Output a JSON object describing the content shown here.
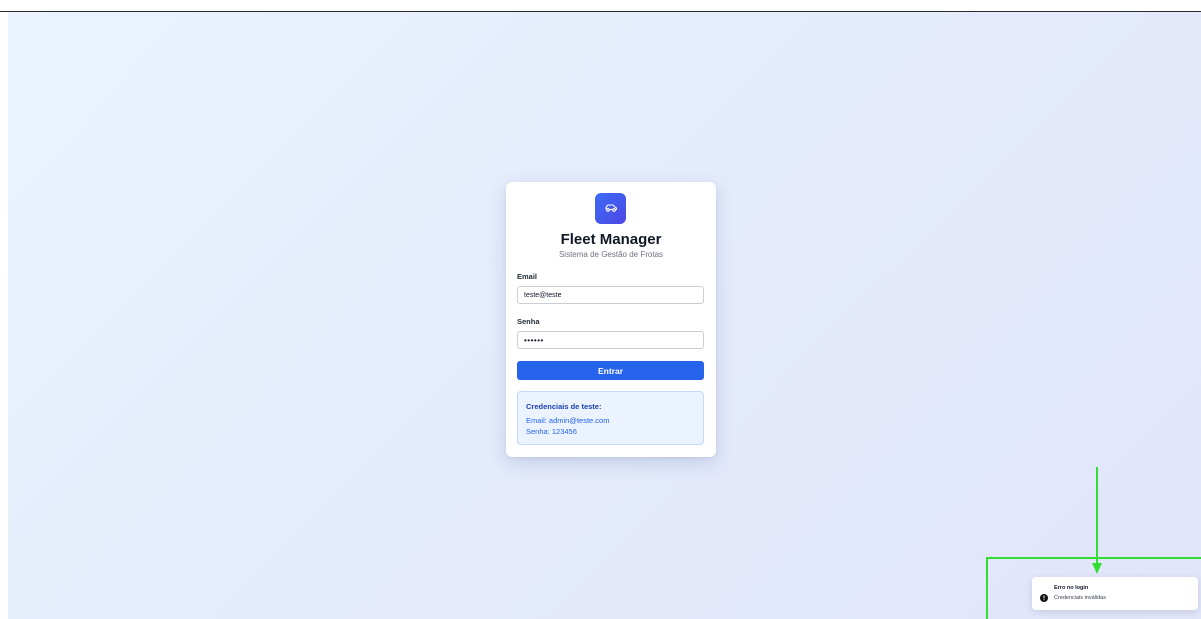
{
  "login": {
    "app_title": "Fleet Manager",
    "subtitle": "Sistema de Gestão de Frotas",
    "email_label": "Email",
    "email_value": "teste@teste",
    "password_label": "Senha",
    "password_value": "••••••",
    "submit_label": "Entrar",
    "credentials": {
      "title": "Credenciais de teste:",
      "email_line": "Email: admin@teste.com",
      "password_line": "Senha: 123456"
    }
  },
  "toast": {
    "title": "Erro no login",
    "message": "Credenciais inválidas"
  },
  "icons": {
    "logo": "car-icon",
    "toast": "alert-circle-icon"
  },
  "colors": {
    "primary": "#2563eb",
    "logo_gradient_start": "#3b6cf5",
    "logo_gradient_end": "#4e47e5",
    "hint_bg": "#eaf3ff",
    "annotation": "#33dd33"
  }
}
